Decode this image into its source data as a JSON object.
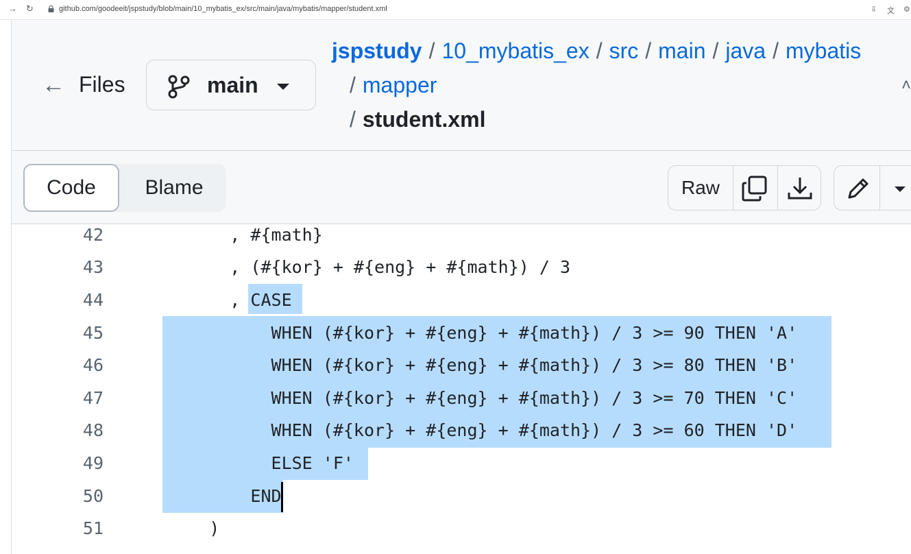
{
  "browser": {
    "url": "github.com/goodeeit/jspstudy/blob/main/10_mybatis_ex/src/main/java/mybatis/mapper/student.xml"
  },
  "header": {
    "back_label": "Files",
    "branch": "main",
    "breadcrumb": {
      "repo": "jspstudy",
      "segments": [
        "10_mybatis_ex",
        "src",
        "main",
        "java",
        "mybatis",
        "mapper"
      ],
      "separator": "/",
      "file": "student.xml"
    }
  },
  "toolbar": {
    "tabs": [
      "Code",
      "Blame"
    ],
    "active_tab": "Code",
    "raw_label": "Raw"
  },
  "code": {
    "lines": [
      {
        "num": "42",
        "text": "      , #{math}"
      },
      {
        "num": "43",
        "text": "      , (#{kor} + #{eng} + #{math}) / 3"
      },
      {
        "num": "44",
        "text": "      , CASE"
      },
      {
        "num": "45",
        "text": "          WHEN (#{kor} + #{eng} + #{math}) / 3 >= 90 THEN 'A'"
      },
      {
        "num": "46",
        "text": "          WHEN (#{kor} + #{eng} + #{math}) / 3 >= 80 THEN 'B'"
      },
      {
        "num": "47",
        "text": "          WHEN (#{kor} + #{eng} + #{math}) / 3 >= 70 THEN 'C'"
      },
      {
        "num": "48",
        "text": "          WHEN (#{kor} + #{eng} + #{math}) / 3 >= 60 THEN 'D'"
      },
      {
        "num": "49",
        "text": "          ELSE 'F'"
      },
      {
        "num": "50",
        "text": "        END"
      },
      {
        "num": "51",
        "text": "    )"
      }
    ],
    "selection_color": "#b6dcfd"
  },
  "colors": {
    "link": "#0969da",
    "text": "#1f2328",
    "muted": "#59636e",
    "header_bg": "#f6f8fa"
  }
}
